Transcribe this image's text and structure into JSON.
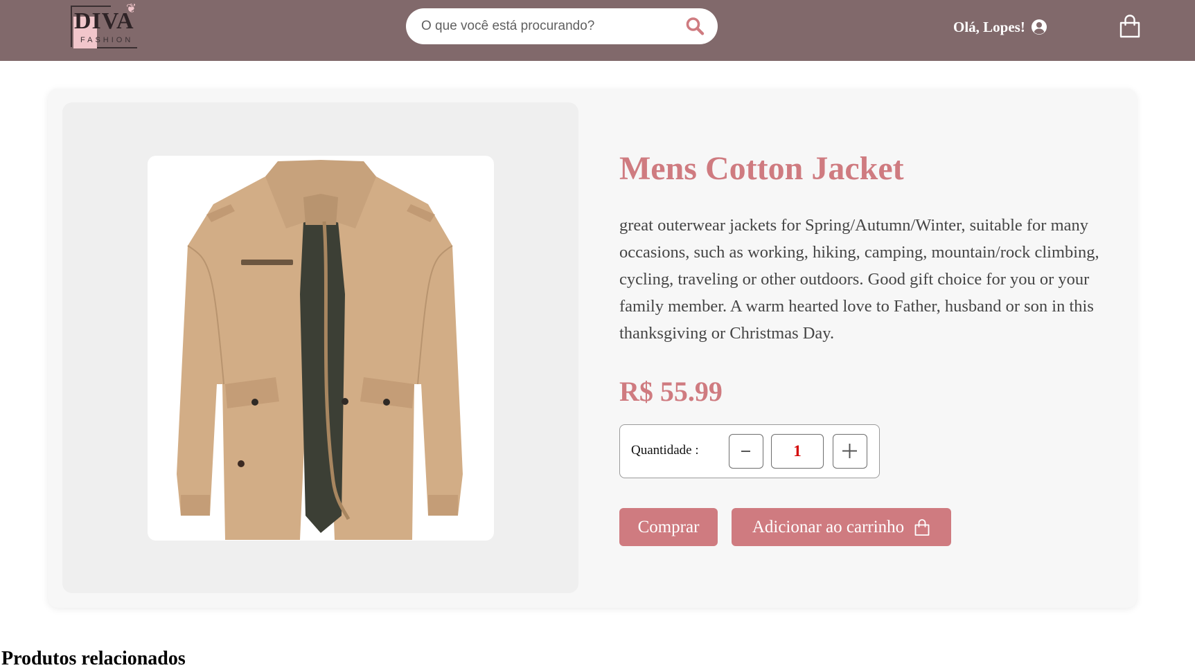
{
  "header": {
    "logo_text": "DIVA",
    "logo_subtext": "FASHION",
    "search_placeholder": "O que você está procurando?",
    "greeting": "Olá, Lopes!",
    "icons": {
      "search": "search-icon",
      "user": "user-circle-icon",
      "cart": "shopping-bag-icon"
    }
  },
  "product": {
    "title": "Mens Cotton Jacket",
    "description": "great outerwear jackets for Spring/Autumn/Winter, suitable for many occasions, such as working, hiking, camping, mountain/rock climbing, cycling, traveling or other outdoors. Good gift choice for you or your family member. A warm hearted love to Father, husband or son in this thanksgiving or Christmas Day.",
    "price": "R$ 55.99",
    "image_alt": "Mens Cotton Jacket",
    "quantity": {
      "label": "Quantidade :",
      "value": "1",
      "minus": "−",
      "plus": "+"
    },
    "buy_label": "Comprar",
    "add_to_cart_label": "Adicionar ao carrinho"
  },
  "related": {
    "title": "Produtos relacionados"
  },
  "colors": {
    "header_bg": "#81696b",
    "accent": "#cf7b80",
    "quantity_value": "#d40000"
  }
}
